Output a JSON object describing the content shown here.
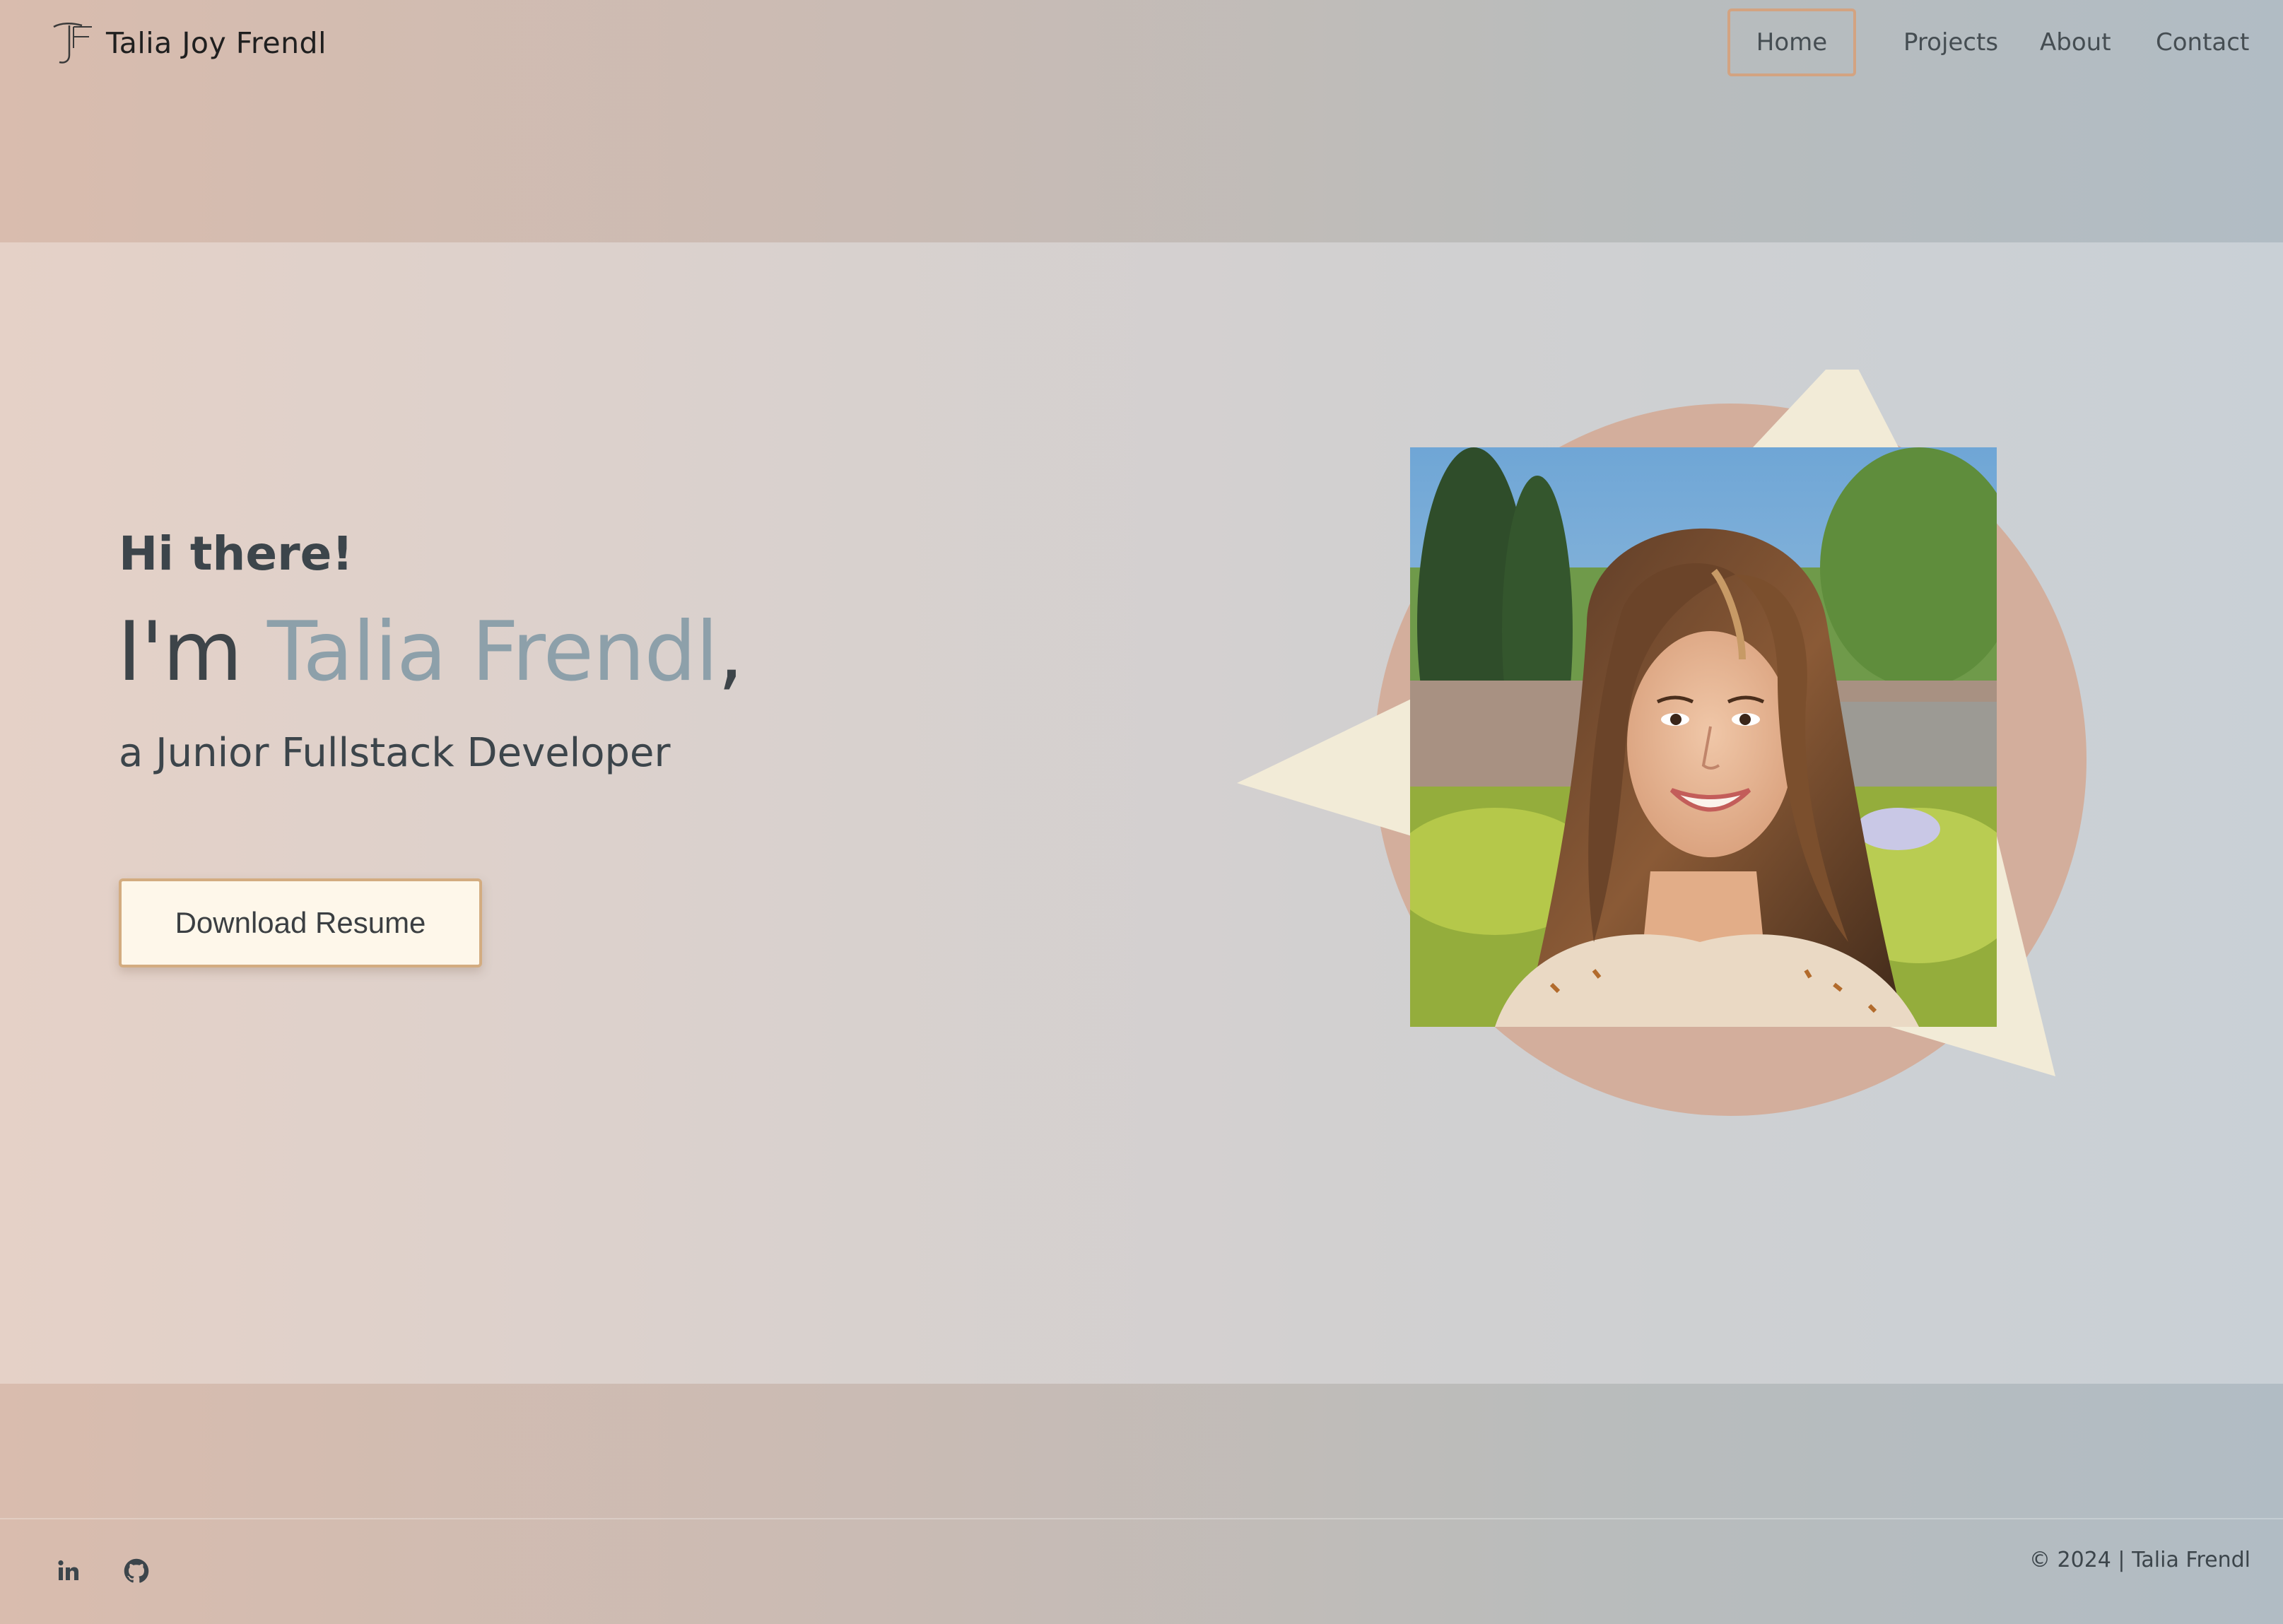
{
  "header": {
    "logo_monogram": "TF",
    "site_name": "Talia Joy Frendl",
    "nav": [
      {
        "label": "Home",
        "active": true
      },
      {
        "label": "Projects",
        "active": false
      },
      {
        "label": "About",
        "active": false
      },
      {
        "label": "Contact",
        "active": false
      }
    ]
  },
  "hero": {
    "greeting": "Hi there!",
    "intro_prefix": "I'm ",
    "intro_name": "Talia Frendl",
    "intro_suffix": ",",
    "role": "a Junior Fullstack Developer",
    "resume_button": "Download Resume",
    "portrait_alt": "Portrait photo of Talia Frendl"
  },
  "footer": {
    "social": [
      {
        "icon": "linkedin-icon"
      },
      {
        "icon": "github-icon"
      }
    ],
    "copyright": "© 2024 | Talia Frendl"
  },
  "colors": {
    "accent_name": "#8da0aa",
    "nav_active_border": "#d3a381",
    "button_bg": "#fef7ea",
    "button_border": "#d3ac80",
    "circle": "#d3ae9c",
    "triangle": "#f2ebd7",
    "text_dark": "#3c454b"
  }
}
